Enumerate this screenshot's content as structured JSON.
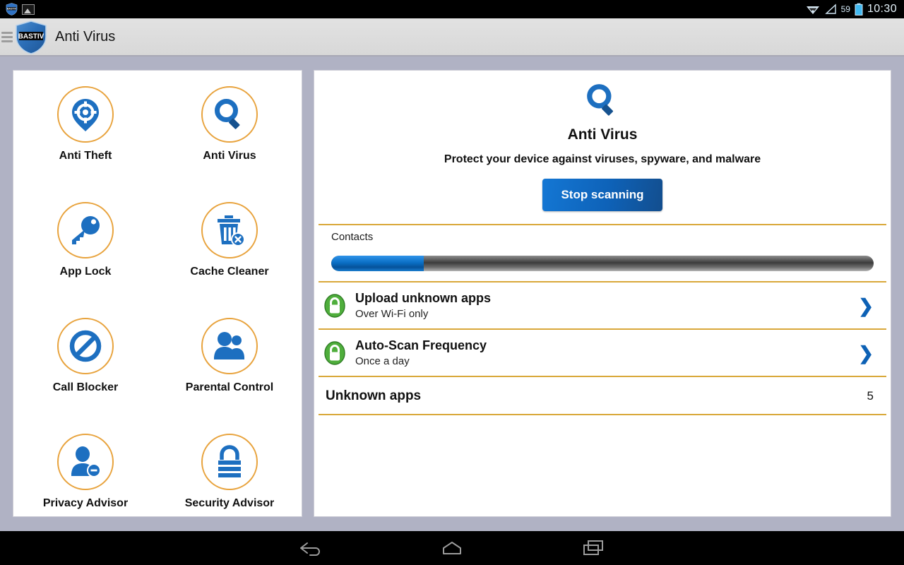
{
  "statusbar": {
    "notif_icons": [
      "bastiv-shield-icon",
      "image-icon"
    ],
    "wifi_icon": "wifi-icon",
    "signal_icon": "signal-icon",
    "battery_percent": "59",
    "battery_icon": "battery-icon",
    "clock": "10:30"
  },
  "actionbar": {
    "menu_icon": "hamburger-menu-icon",
    "logo_text": "BASTIV",
    "title": "Anti Virus"
  },
  "features": [
    {
      "label": "Anti Theft",
      "icon": "location-pin-target-icon"
    },
    {
      "label": "Anti Virus",
      "icon": "magnifier-icon"
    },
    {
      "label": "App Lock",
      "icon": "key-icon"
    },
    {
      "label": "Cache Cleaner",
      "icon": "trash-can-delete-icon"
    },
    {
      "label": "Call Blocker",
      "icon": "no-entry-icon"
    },
    {
      "label": "Parental Control",
      "icon": "two-people-icon"
    },
    {
      "label": "Privacy Advisor",
      "icon": "person-minus-icon"
    },
    {
      "label": "Security Advisor",
      "icon": "padlock-icon"
    }
  ],
  "detail": {
    "header_icon": "magnifier-icon",
    "title": "Anti Virus",
    "subtitle": "Protect your device against viruses, spyware, and malware",
    "scan_button_label": "Stop scanning",
    "progress": {
      "label": "Contacts",
      "percent": 17
    },
    "settings": [
      {
        "icon": "green-lock-icon",
        "title": "Upload unknown apps",
        "value": "Over Wi-Fi only",
        "chevron": "chevron-right-icon"
      },
      {
        "icon": "green-lock-icon",
        "title": "Auto-Scan Frequency",
        "value": "Once a day",
        "chevron": "chevron-right-icon"
      }
    ],
    "unknown_apps": {
      "title": "Unknown apps",
      "count": "5"
    }
  },
  "navbar": {
    "back": "back-icon",
    "home": "home-icon",
    "recents": "recents-icon"
  },
  "colors": {
    "accent_orange": "#e8a33d",
    "divider_gold": "#d9a83a",
    "brand_blue": "#0d61b5",
    "lock_green": "#4fae3c",
    "page_bg": "#b0b2c4"
  }
}
